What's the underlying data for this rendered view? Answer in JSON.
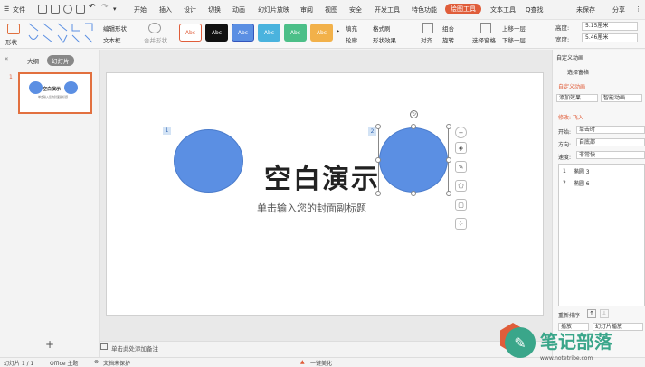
{
  "menubar": {
    "file_label": "文件",
    "tabs": [
      "开始",
      "插入",
      "设计",
      "切换",
      "动画",
      "幻灯片放映",
      "审阅",
      "视图",
      "安全",
      "开发工具",
      "特色功能",
      "绘图工具",
      "文本工具"
    ],
    "search_label": "Q查找",
    "unsaved_label": "未保存",
    "share_label": "分享"
  },
  "ribbon": {
    "shape_label": "形状",
    "edit_shape_label": "编辑形状",
    "textbox_label": "文本框",
    "merge_shape_label": "合并形状",
    "style_samples": [
      "Abc",
      "Abc",
      "Abc",
      "Abc",
      "Abc",
      "Abc"
    ],
    "fill_label": "填充",
    "format_painter_label": "格式刷",
    "outline_label": "轮廓",
    "shape_effect_label": "形状效果",
    "align_label": "对齐",
    "group_label": "组合",
    "rotate_label": "旋转",
    "selection_pane_label": "选择窗格",
    "bring_forward_label": "上移一层",
    "send_backward_label": "下移一层",
    "height_label": "高度:",
    "height_value": "5.15厘米",
    "width_label": "宽度:",
    "width_value": "5.46厘米"
  },
  "leftpanel": {
    "outline_tab": "大纲",
    "slides_tab": "幻灯片",
    "slide_number": "1",
    "thumb_title": "空白演示",
    "thumb_subtitle": "单击输入您的封面副标题",
    "add_label": "+"
  },
  "slide": {
    "title": "空白演示",
    "subtitle": "单击输入您的封面副标题",
    "badge_1": "1",
    "badge_2": "2"
  },
  "notes_placeholder": "单击此处添加备注",
  "rightpanel": {
    "header": "自定义动画",
    "selection_pane": "选择窗格",
    "section_title": "自定义动画",
    "add_effect": "添加效果",
    "smart_animation": "智能动画",
    "modify_label": "修改: 飞入",
    "start_label": "开始:",
    "start_value": "单击时",
    "direction_label": "方向:",
    "direction_value": "自底部",
    "speed_label": "速度:",
    "speed_value": "非常快",
    "list_items": [
      {
        "num": "1",
        "name": "椭圆 3"
      },
      {
        "num": "2",
        "name": "椭圆 6"
      }
    ],
    "reorder_label": "重新排序",
    "play_label": "播放",
    "slideshow_label": "幻灯片播放"
  },
  "statusbar": {
    "slide_info": "幻灯片 1 / 1",
    "theme": "Office 主题",
    "protection": "文档未保护",
    "beautify": "一键美化"
  },
  "watermark": {
    "text": "笔记部落",
    "url": "www.notetribe.com"
  },
  "colors": {
    "accent": "#e05d3a",
    "circle_fill": "#5b8fe3"
  }
}
